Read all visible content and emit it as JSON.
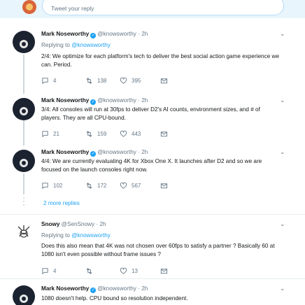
{
  "compose": {
    "placeholder": "Tweet your reply"
  },
  "replying_label": "Replying to",
  "more_replies": "2 more replies",
  "tweets": [
    {
      "name": "Mark Noseworthy",
      "handle": "@knowsworthy",
      "sep": "·",
      "time": "2h",
      "replying_to": "@knowsworthy",
      "text": "2/4: We optimize for each platform's tech to deliver the best social action game experience we can. Period.",
      "replies": "4",
      "retweets": "138",
      "likes": "395"
    },
    {
      "name": "Mark Noseworthy",
      "handle": "@knowsworthy",
      "sep": "·",
      "time": "2h",
      "text": "3/4: All consoles will run at 30fps to deliver D2's AI counts, environment sizes, and # of players. They are all CPU-bound.",
      "replies": "21",
      "retweets": "159",
      "likes": "443"
    },
    {
      "name": "Mark Noseworthy",
      "handle": "@knowsworthy",
      "sep": "·",
      "time": "2h",
      "text": "4/4: We are currently evaluating 4K for Xbox One X. It launches after D2 and so we are focused on the launch consoles right now.",
      "replies": "102",
      "retweets": "172",
      "likes": "567"
    },
    {
      "name": "Snowy",
      "handle": "@SenSnowy",
      "sep": "·",
      "time": "2h",
      "replying_to": "@knowsworthy",
      "text": "Does this also mean that 4K was not chosen over 60fps to satisfy a partner ? Basically 60 at 1080 isn't even possible without frame issues ?",
      "replies": "4",
      "retweets": "",
      "likes": "13"
    },
    {
      "name": "Mark Noseworthy",
      "handle": "@knowsworthy",
      "sep": "·",
      "time": "2h",
      "text": "1080 doesn't help. CPU bound so resolution independent."
    }
  ],
  "colors": {
    "accent": "#1da1f2",
    "muted": "#657786",
    "compose_bg": "#e8f5fd"
  },
  "icons": [
    "reply-icon",
    "retweet-icon",
    "like-icon",
    "message-icon",
    "verified-icon",
    "chevron-down-icon"
  ]
}
